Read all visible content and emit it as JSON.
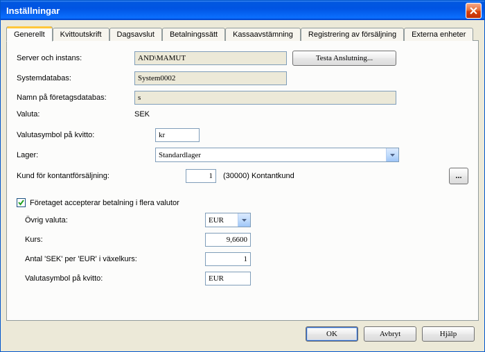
{
  "window": {
    "title": "Inställningar"
  },
  "tabs": [
    "Generellt",
    "Kvittoutskrift",
    "Dagsavslut",
    "Betalningssätt",
    "Kassaavstämning",
    "Registrering av försäljning",
    "Externa enheter"
  ],
  "active_tab": 0,
  "labels": {
    "server": "Server och instans:",
    "sysdb": "Systemdatabas:",
    "compdb": "Namn på företagsdatabas:",
    "currency": "Valuta:",
    "cursym": "Valutasymbol på kvitto:",
    "warehouse": "Lager:",
    "cashcust": "Kund för kontantförsäljning:",
    "multi": "Företaget accepterar betalning i flera valutor",
    "othercur": "Övrig valuta:",
    "rate": "Kurs:",
    "per": "Antal 'SEK' per 'EUR' i växelkurs:",
    "cursym2": "Valutasymbol på kvitto:"
  },
  "values": {
    "server": "AND\\MAMUT",
    "sysdb": "System0002",
    "compdb": "s",
    "currency": "SEK",
    "cursym": "kr",
    "warehouse": "Standardlager",
    "cashcust_num": "1",
    "cashcust_text": "(30000) Kontantkund",
    "multi_checked": true,
    "othercur": "EUR",
    "rate": "9,6600",
    "per": "1",
    "cursym2": "EUR"
  },
  "buttons": {
    "test": "Testa Anslutning...",
    "ok": "OK",
    "cancel": "Avbryt",
    "help": "Hjälp",
    "browse": "..."
  }
}
